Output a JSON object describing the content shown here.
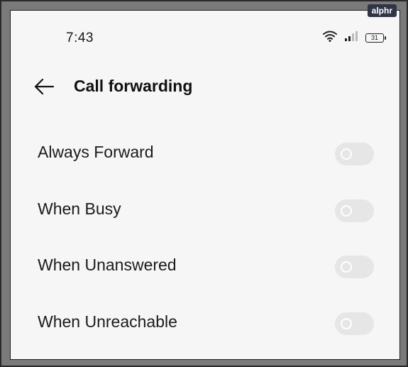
{
  "watermark": "alphr",
  "status_bar": {
    "time": "7:43",
    "battery_level": "31",
    "icons": [
      "wifi-icon",
      "signal-icon",
      "battery-icon"
    ]
  },
  "header": {
    "title": "Call forwarding",
    "back_icon": "arrow-left-icon"
  },
  "options": [
    {
      "label": "Always Forward",
      "enabled": false
    },
    {
      "label": "When Busy",
      "enabled": false
    },
    {
      "label": "When Unanswered",
      "enabled": false
    },
    {
      "label": "When Unreachable",
      "enabled": false
    }
  ],
  "colors": {
    "background": "#f6f6f6",
    "toggle_off": "#e6e6e6",
    "text": "#1b1b1b",
    "watermark_bg": "#2f3446"
  }
}
